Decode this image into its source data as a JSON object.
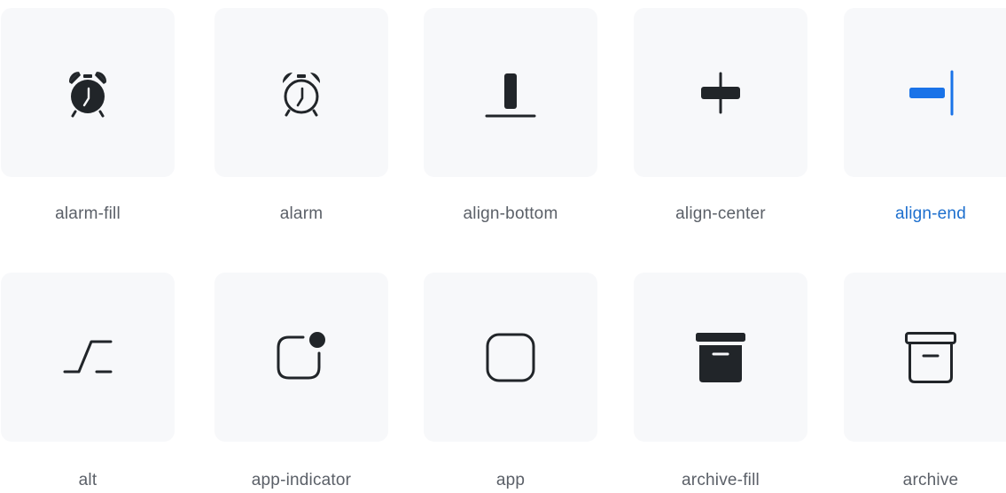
{
  "icons": [
    {
      "name": "alarm-fill",
      "selected": false
    },
    {
      "name": "alarm",
      "selected": false
    },
    {
      "name": "align-bottom",
      "selected": false
    },
    {
      "name": "align-center",
      "selected": false
    },
    {
      "name": "align-end",
      "selected": true
    },
    {
      "name": "alt",
      "selected": false
    },
    {
      "name": "app-indicator",
      "selected": false
    },
    {
      "name": "app",
      "selected": false
    },
    {
      "name": "archive-fill",
      "selected": false
    },
    {
      "name": "archive",
      "selected": false
    }
  ],
  "colors": {
    "tile_bg": "#f7f8fa",
    "icon": "#212529",
    "label": "#5b6068",
    "accent": "#1d6fce",
    "accent_icon": "#1a73e8"
  }
}
